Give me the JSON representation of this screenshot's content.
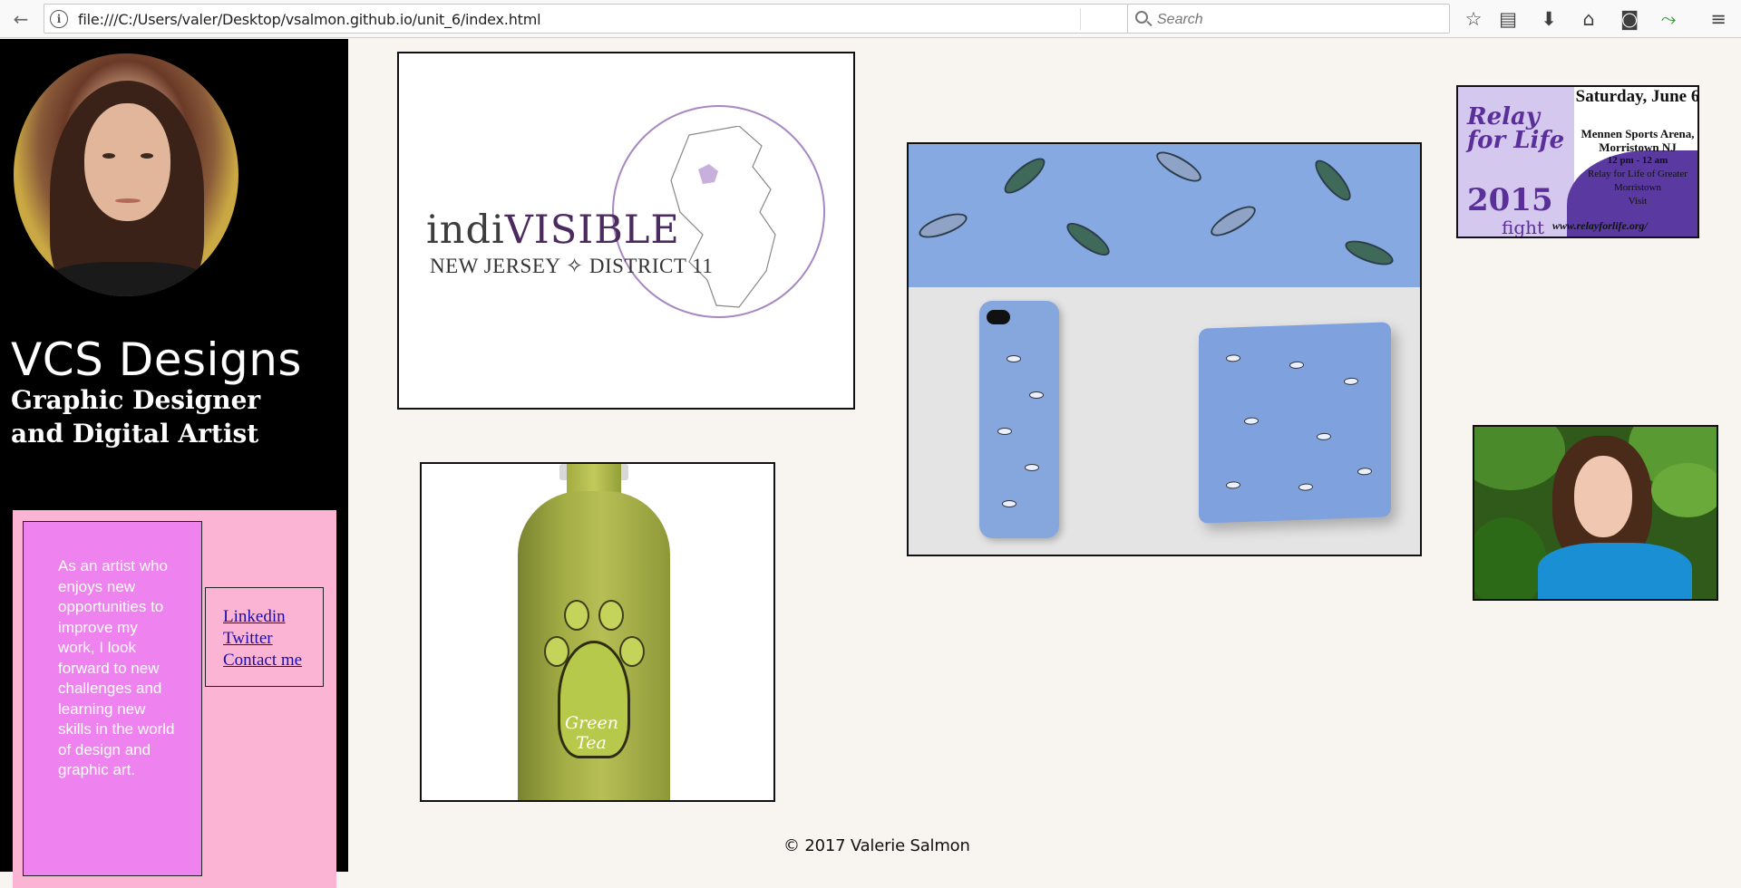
{
  "browser": {
    "url": "file:///C:/Users/valer/Desktop/vsalmon.github.io/unit_6/index.html",
    "search_placeholder": "Search"
  },
  "sidebar": {
    "brand": "VCS Designs",
    "tagline": "Graphic Designer and Digital Artist",
    "bio": "As an artist who enjoys new opportunities to improve my work, I look forward to new challenges and learning new skills in the world of design and graphic art.",
    "links": [
      {
        "label": "Linkedin"
      },
      {
        "label": "Twitter"
      },
      {
        "label": "Contact me"
      }
    ]
  },
  "gallery": {
    "indivisible": {
      "word_a": "indi",
      "word_b": "VISIBLE",
      "subtitle": "NEW JERSEY ✧ DISTRICT 11"
    },
    "tea": {
      "label_line1": "Green",
      "label_line2": "Tea"
    },
    "relay": {
      "title": "Relay for Life",
      "year": "2015",
      "fight": "fight",
      "date": "Saturday, June 6",
      "venue": "Mennen Sports Arena, Morristown NJ",
      "time": "12 pm - 12 am",
      "org": "Relay for Life of Greater Morristown",
      "visit": "Visit",
      "url": "www.relayforlife.org/"
    }
  },
  "footer": {
    "copyright": "© 2017 Valerie Salmon"
  },
  "colors": {
    "sidebar_bg": "#000000",
    "pink_panel": "#fbb4d4",
    "bio_bg": "#ee82ee",
    "page_bg": "#f8f4f0",
    "link": "#1a0dab"
  }
}
